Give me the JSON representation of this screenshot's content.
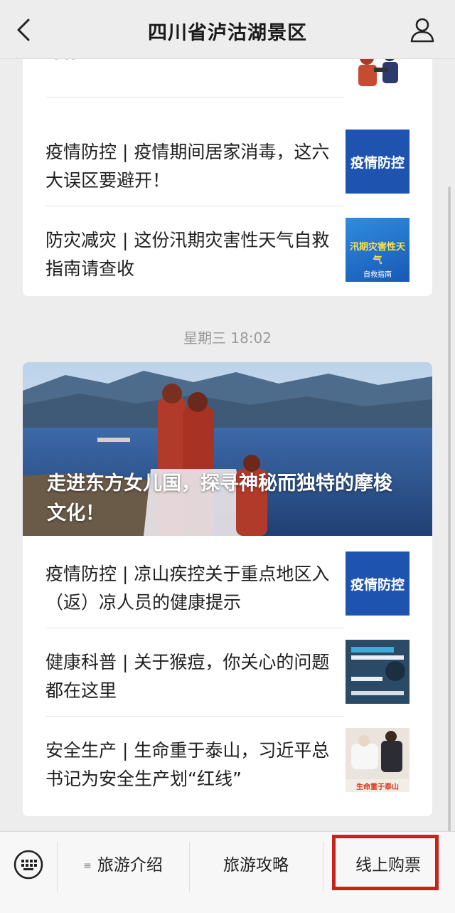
{
  "header": {
    "title": "四川省泸沽湖景区",
    "back_icon": "back-chevron-icon",
    "user_icon": "user-profile-icon"
  },
  "card1": {
    "items": [
      {
        "text": "好你的钱袋子",
        "thumb_label": ""
      },
      {
        "text": "疫情防控 | 疫情期间居家消毒，这六大误区要避开！",
        "thumb_label": "疫情防控"
      },
      {
        "text": "防灾减灾 | 这份汛期灾害性天气自救指南请查收",
        "thumb_label": "汛期灾害性天气",
        "thumb_sublabel": "自救指南"
      }
    ]
  },
  "timestamp": "星期三 18:02",
  "card2": {
    "hero_title": "走进东方女儿国，探寻神秘而独特的摩梭文化！",
    "items": [
      {
        "text": "疫情防控 | 凉山疾控关于重点地区入（返）凉人员的健康提示",
        "thumb_label": "疫情防控"
      },
      {
        "text": "健康科普 | 关于猴痘，你关心的问题都在这里",
        "thumb_label": ""
      },
      {
        "text": "安全生产 | 生命重于泰山，习近平总书记为安全生产划“红线”",
        "thumb_label": "生命重于泰山"
      }
    ]
  },
  "bottom_menu": {
    "keyboard_icon": "keyboard-icon",
    "items": [
      {
        "label": "旅游介绍",
        "has_submenu": true
      },
      {
        "label": "旅游攻略",
        "has_submenu": false
      },
      {
        "label": "线上购票",
        "has_submenu": false,
        "highlighted": true
      }
    ]
  },
  "colors": {
    "background": "#ededed",
    "card": "#ffffff",
    "thumb_blue": "#1e54b0",
    "highlight_red": "#c6241a"
  }
}
